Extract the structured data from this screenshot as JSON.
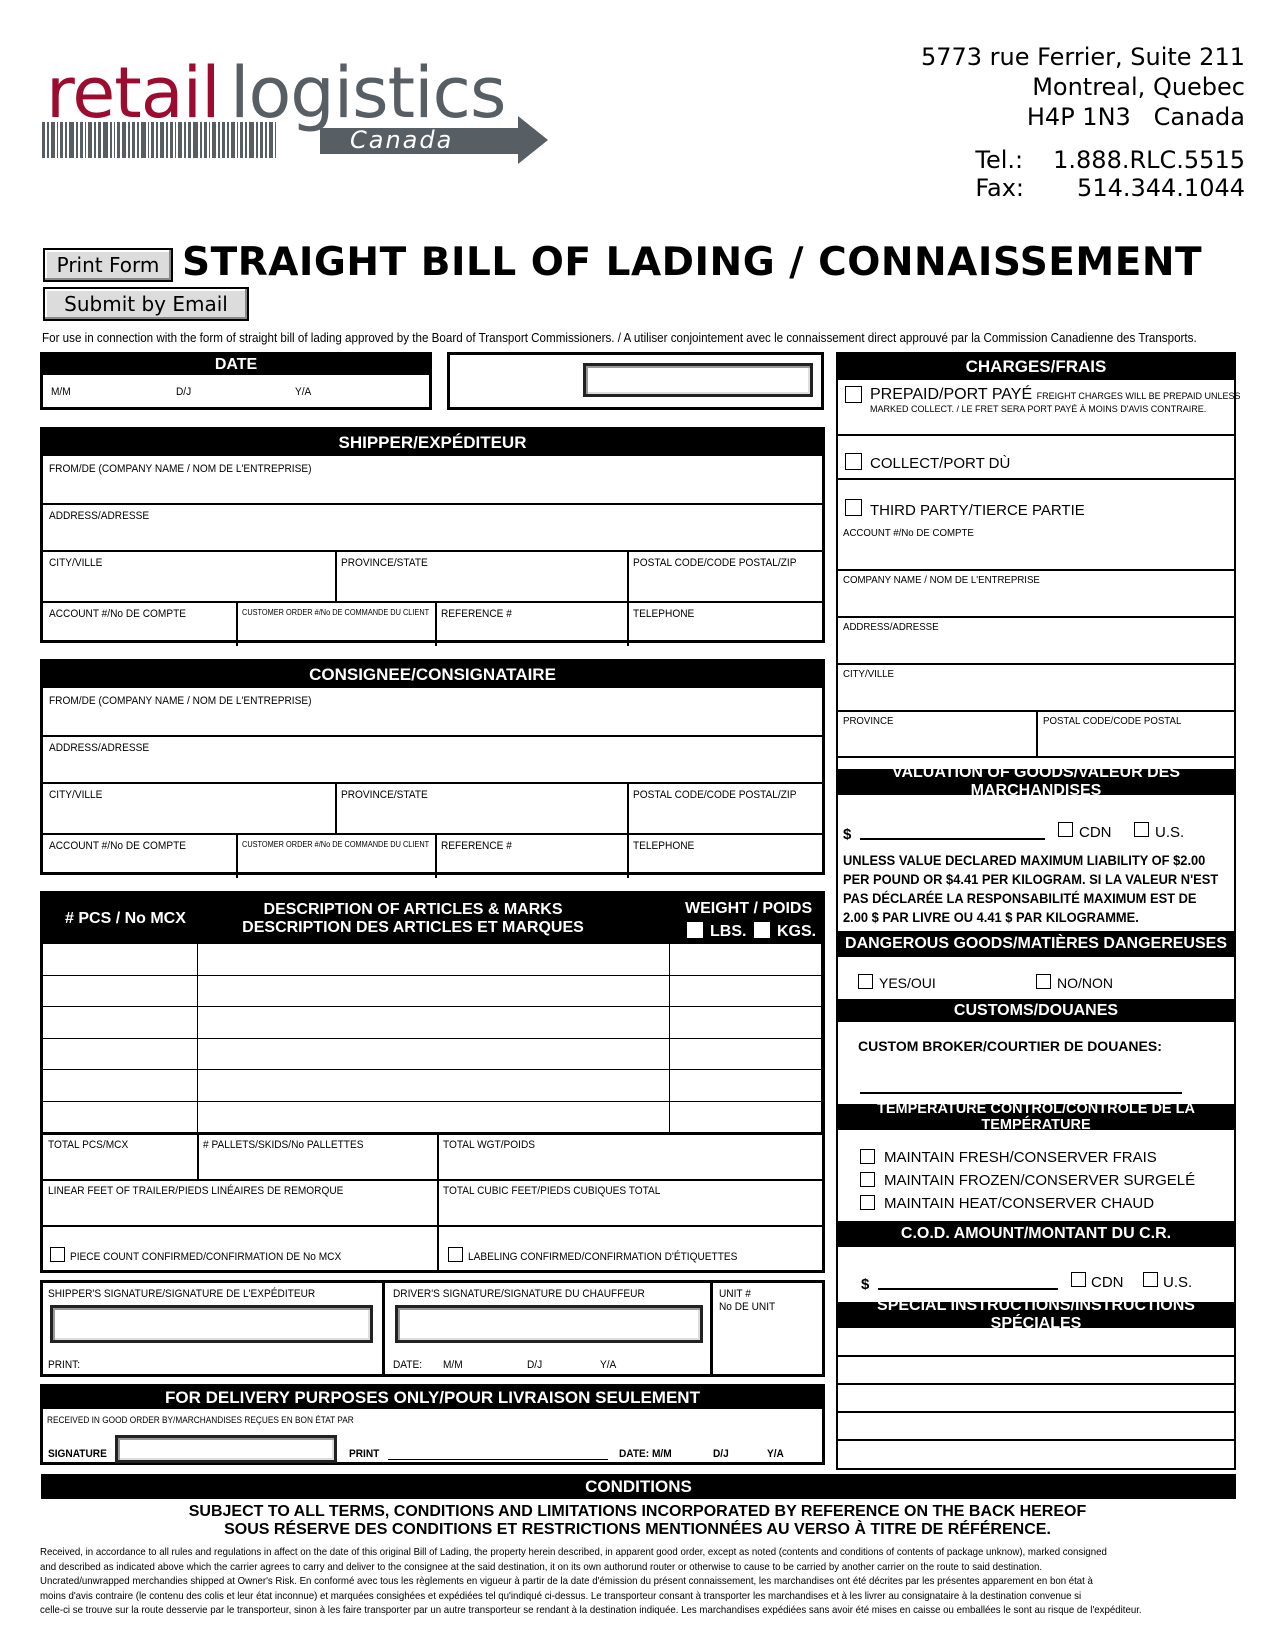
{
  "logo": {
    "word1": "retail",
    "word2": "logistics",
    "sub": "Canada",
    "brand_color": "#9b0c2f",
    "gray_color": "#575e64"
  },
  "address": {
    "line1": "5773 rue Ferrier, Suite 211",
    "line2": "Montreal, Quebec",
    "line3": "H4P 1N3   Canada"
  },
  "contact": {
    "tel_label": "Tel.:",
    "tel": "1.888.RLC.5515",
    "fax_label": "Fax:",
    "fax": "514.344.1044"
  },
  "buttons": {
    "print": "Print Form",
    "email": "Submit by Email"
  },
  "title": "STRAIGHT BILL OF LADING / CONNAISSEMENT",
  "intro": "For use in connection with the form of straight bill of lading approved by the Board of Transport Commissioners. / A utiliser conjointement avec le connaissement direct approuvé par la Commission Canadienne des Transports.",
  "date": {
    "header": "DATE",
    "mm": "M/M",
    "dj": "D/J",
    "ya": "Y/A"
  },
  "shipper": {
    "header": "SHIPPER/EXPÉDITEUR",
    "from": "FROM/DE (COMPANY NAME / NOM DE L'ENTREPRISE)",
    "address": "ADDRESS/ADRESSE",
    "city": "CITY/VILLE",
    "province": "PROVINCE/STATE",
    "postal": "POSTAL CODE/CODE POSTAL/ZIP",
    "account": "ACCOUNT #/No DE COMPTE",
    "customer_order": "CUSTOMER ORDER #/No DE COMMANDE DU CLIENT",
    "reference": "REFERENCE #",
    "telephone": "TELEPHONE"
  },
  "consignee": {
    "header": "CONSIGNEE/CONSIGNATAIRE",
    "from": "FROM/DE (COMPANY NAME / NOM DE L'ENTREPRISE)",
    "address": "ADDRESS/ADRESSE",
    "city": "CITY/VILLE",
    "province": "PROVINCE/STATE",
    "postal": "POSTAL CODE/CODE POSTAL/ZIP",
    "account": "ACCOUNT #/No DE COMPTE",
    "customer_order": "CUSTOMER ORDER #/No DE COMMANDE DU CLIENT",
    "reference": "REFERENCE #",
    "telephone": "TELEPHONE"
  },
  "articles": {
    "col_pcs": "# PCS / No MCX",
    "col_desc1": "DESCRIPTION OF ARTICLES & MARKS",
    "col_desc2": "DESCRIPTION DES ARTICLES ET MARQUES",
    "col_weight": "WEIGHT / POIDS",
    "lbs": "LBS.",
    "kgs": "KGS.",
    "total_pcs": "TOTAL PCS/MCX",
    "pallets": "# PALLETS/SKIDS/No PALLETTES",
    "total_wgt": "TOTAL WGT/POIDS",
    "linear_feet": "LINEAR FEET OF TRAILER/PIEDS LINÉAIRES DE REMORQUE",
    "cubic_feet": "TOTAL CUBIC FEET/PIEDS CUBIQUES TOTAL",
    "piece_count": "PIECE COUNT CONFIRMED/CONFIRMATION DE No MCX",
    "labeling": "LABELING CONFIRMED/CONFIRMATION D'ÉTIQUETTES"
  },
  "signatures": {
    "shipper": "SHIPPER'S SIGNATURE/SIGNATURE DE L'EXPÉDITEUR",
    "print": "PRINT:",
    "driver": "DRIVER'S SIGNATURE/SIGNATURE DU CHAUFFEUR",
    "date": "DATE:",
    "mm": "M/M",
    "dj": "D/J",
    "ya": "Y/A",
    "unit1": "UNIT #",
    "unit2": "No DE UNIT"
  },
  "delivery": {
    "header": "FOR DELIVERY PURPOSES ONLY/POUR LIVRAISON SEULEMENT",
    "received": "RECEIVED IN GOOD ORDER BY/MARCHANDISES REÇUES EN BON ÉTAT PAR",
    "signature": "SIGNATURE",
    "print": "PRINT",
    "date": "DATE:  M/M",
    "dj": "D/J",
    "ya": "Y/A"
  },
  "charges": {
    "header": "CHARGES/FRAIS",
    "prepaid": "PREPAID/PORT PAYÉ",
    "prepaid_note1": "FREIGHT CHARGES WILL BE PREPAID UNLESS",
    "prepaid_note2": "MARKED COLLECT. / LE FRET SERA PORT PAYÉ À MOINS D'AVIS CONTRAIRE.",
    "collect": "COLLECT/PORT DÙ",
    "third_party": "THIRD PARTY/TIERCE PARTIE",
    "account": "ACCOUNT #/No DE COMPTE",
    "company": "COMPANY NAME / NOM DE L'ENTREPRISE",
    "address": "ADDRESS/ADRESSE",
    "city": "CITY/VILLE",
    "province": "PROVINCE",
    "postal": "POSTAL CODE/CODE POSTAL"
  },
  "valuation": {
    "header": "VALUATION OF GOODS/VALEUR DES MARCHANDISES",
    "dollar": "$",
    "cdn": "CDN",
    "us": "U.S.",
    "note": [
      "UNLESS VALUE DECLARED MAXIMUM LIABILITY OF $2.00",
      "PER POUND OR $4.41 PER KILOGRAM.  SI LA VALEUR N'EST",
      "PAS DÉCLARÉE LA RESPONSABILITÉ MAXIMUM EST DE",
      "2.00 $ PAR LIVRE OU 4.41 $ PAR KILOGRAMME."
    ]
  },
  "dangerous": {
    "header": "DANGEROUS GOODS/MATIÈRES DANGEREUSES",
    "yes": "YES/OUI",
    "no": "NO/NON"
  },
  "customs": {
    "header": "CUSTOMS/DOUANES",
    "broker": "CUSTOM BROKER/COURTIER DE DOUANES:"
  },
  "temperature": {
    "header": "TEMPERATURE CONTROL/CONTRÔLE DE LA TEMPÉRATURE",
    "options": [
      "MAINTAIN FRESH/CONSERVER FRAIS",
      "MAINTAIN FROZEN/CONSERVER SURGELÉ",
      "MAINTAIN HEAT/CONSERVER CHAUD"
    ]
  },
  "cod": {
    "header": "C.O.D. AMOUNT/MONTANT DU C.R.",
    "dollar": "$",
    "cdn": "CDN",
    "us": "U.S."
  },
  "special": {
    "header": "SPECIAL INSTRUCTIONS/INSTRUCTIONS SPÉCIALES"
  },
  "conditions": {
    "header": "CONDITIONS",
    "line1": "SUBJECT TO ALL TERMS, CONDITIONS AND LIMITATIONS INCORPORATED BY REFERENCE ON THE BACK HEREOF",
    "line2": "SOUS RÉSERVE DES CONDITIONS ET RESTRICTIONS MENTIONNÉES AU VERSO À TITRE DE RÉFÉRENCE.",
    "body": [
      "Received, in accordance to all rules and regulations in affect on the date of this original Bill of Lading, the property herein described, in apparent good order, except as noted (contents and conditions of contents of package unknow), marked consigned",
      "and described as indicated above which the carrier agrees to carry and deliver to the consignee at the said destination, it on its own authorund router or otherwise to cause to be carried by another carrier on the route to said destination.",
      "Uncrated/unwrapped merchandies shipped at Owner's Risk.  En conformé avec tous les règlements en vigueur à partir de la date d'émission du présent connaissement, les marchandises ont été décrites par les présentes apparement en bon état à",
      "moins d'avis contraire (le contenu des colis et leur état inconnue) et marquées consighées et expédiées tel qu'indiqué ci-dessus. Le transporteur consant à transporter les marchandises et à les livrer au consignataire à la destination convenue si",
      "celle-ci se trouve sur la route desservie par le transporteur, sinon à les faire transporter par un autre transporteur se rendant à la destination indiquée. Les marchandises expédiées sans avoir été mises en caisse ou emballées le sont au risque de l'expéditeur."
    ]
  }
}
